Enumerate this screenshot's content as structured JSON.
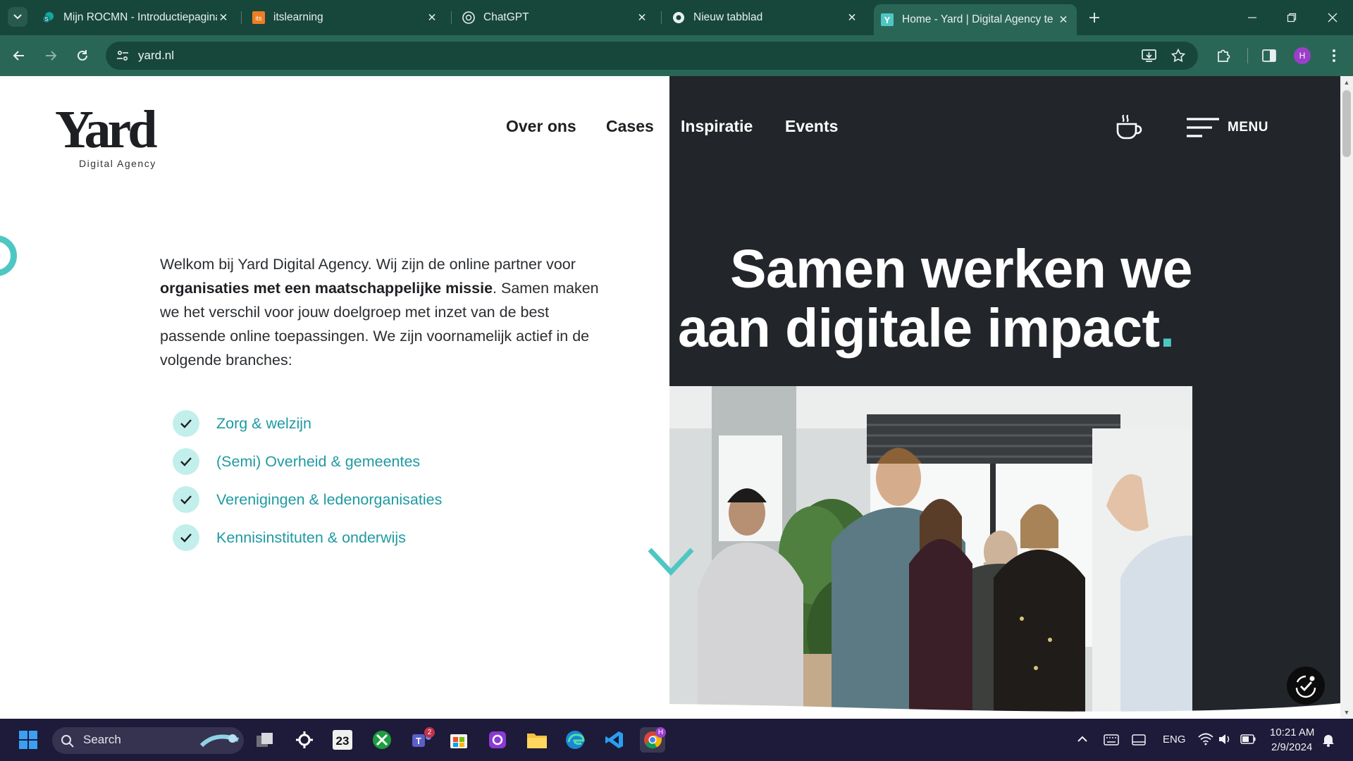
{
  "browser": {
    "tabs": [
      {
        "title": "Mijn ROCMN - Introductiepagina",
        "favicon": "sharepoint-icon"
      },
      {
        "title": "itslearning",
        "favicon": "itslearning-icon"
      },
      {
        "title": "ChatGPT",
        "favicon": "chatgpt-icon"
      },
      {
        "title": "Nieuw tabblad",
        "favicon": "chrome-icon"
      },
      {
        "title": "Home - Yard | Digital Agency te",
        "favicon": "yard-icon",
        "active": true
      }
    ],
    "url": "yard.nl",
    "profile_initial": "H"
  },
  "site": {
    "logo": {
      "word": "Yard",
      "subtitle": "Digital Agency"
    },
    "nav": [
      "Over ons",
      "Cases",
      "Inspiratie",
      "Events"
    ],
    "menu_label": "MENU",
    "intro": {
      "part1": "Welkom bij Yard Digital Agency. Wij zijn de online partner voor ",
      "bold": "organisaties met een maatschappelijke missie",
      "part2": ". Samen maken we het verschil voor jouw doelgroep met inzet van de best passende online toepassingen. We zijn voornamelijk actief in de volgende branches:"
    },
    "branches": [
      "Zorg & welzijn",
      "(Semi) Overheid & gemeentes",
      "Verenigingen & ledenorganisaties",
      "Kennisinstituten & onderwijs"
    ],
    "hero": {
      "line1": "Samen werken we",
      "line2": "aan digitale impact",
      "dot": "."
    }
  },
  "taskbar": {
    "search_label": "Search",
    "calendar_day": "23",
    "teams_badge": "2",
    "chrome_badge": "H",
    "language": "ENG",
    "time": "10:21 AM",
    "date": "2/9/2024"
  },
  "colors": {
    "chrome_dark": "#17473b",
    "chrome_toolbar": "#2a6656",
    "site_dark": "#22262b",
    "accent_teal": "#4ec7c4",
    "link_teal": "#1e9aa2",
    "taskbar": "#1d1b39"
  }
}
